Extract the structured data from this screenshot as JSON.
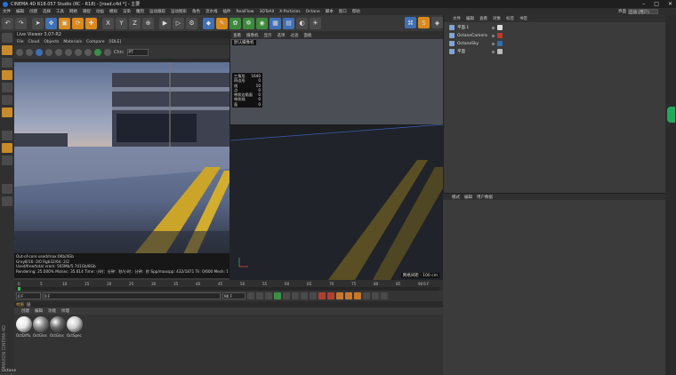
{
  "window": {
    "title": "CINEMA 4D R18.057 Studio (RC - R18) - [road.c4d *] - 主要"
  },
  "menu": {
    "items": [
      "文件",
      "编辑",
      "创建",
      "选择",
      "工具",
      "网格",
      "捕捉",
      "动画",
      "模拟",
      "渲染",
      "雕刻",
      "运动跟踪",
      "运动图形",
      "角色",
      "流水线",
      "插件",
      "RealFlow",
      "3DToAll",
      "X-Particles",
      "Octane",
      "脚本",
      "窗口",
      "帮助"
    ],
    "layout_label": "界面",
    "layout_value": "启动 (用户)"
  },
  "toolbar": {
    "icons": [
      "undo-icon",
      "redo-icon",
      "select-arrow-icon",
      "move-icon",
      "scale-icon",
      "rotate-icon",
      "plus-icon",
      "x-axis-icon",
      "y-axis-icon",
      "z-axis-icon",
      "coordinate-icon",
      "cube-icon",
      "pen-icon",
      "subdivide-icon",
      "array-icon",
      "deformer-icon",
      "floor-icon",
      "camera-icon",
      "light-icon"
    ],
    "x_label": "X",
    "y_label": "Y",
    "z_label": "Z"
  },
  "live_viewer": {
    "title": "Live Viewer 3.07-R2",
    "menu": [
      "File",
      "Cloud",
      "Objects",
      "Materials",
      "Compare",
      "[IDLE]"
    ],
    "channel_label": "Chn:",
    "channel_value": "PT",
    "info": [
      "Out-of-core used/max:0Kb/4Gb",
      "Grey8/16: 0/0      Rgb32/64: 2/2",
      "Used/free/total vram: 565Mb/5.741Gb/8Gb",
      "Rendering: 25.000%   Ms/sec: 35.614   Time: 小时：分钟：秒/小时：分钟：秒   Spp/maxspp: 432/1871   Tri: 0/600   Mesh: 1   Hai"
    ]
  },
  "viewport": {
    "menu": [
      "查看",
      "摄像机",
      "显示",
      "选项",
      "过滤",
      "面板"
    ],
    "label": "默认摄像机",
    "stats": [
      {
        "k": "三角形",
        "v": "1640"
      },
      {
        "k": "四边形",
        "v": "0"
      },
      {
        "k": "线",
        "v": "10"
      },
      {
        "k": "点",
        "v": "0"
      },
      {
        "k": "带状边角面",
        "v": "0"
      },
      {
        "k": "带状线",
        "v": "0"
      },
      {
        "k": "面",
        "v": "0"
      }
    ],
    "grid_label": "网格间距 : 100 cm"
  },
  "timeline": {
    "ticks": [
      "0",
      "5",
      "10",
      "15",
      "20",
      "25",
      "30",
      "35",
      "40",
      "45",
      "50",
      "55",
      "60",
      "65",
      "70",
      "75",
      "80",
      "85",
      "90"
    ],
    "current_frame": "0 F",
    "start_frame": "0 F",
    "end_frame": "90 F",
    "max_frame": "90 F",
    "end_label": "0 F"
  },
  "materials": {
    "tabs": [
      "材质",
      "层"
    ],
    "menu": [
      "创建",
      "编辑",
      "功能",
      "纹理"
    ],
    "items": [
      {
        "name": "OctDiffu",
        "color": "#e8e8e8"
      },
      {
        "name": "OctGlos",
        "color": "#8a8a8a"
      },
      {
        "name": "OctGlos",
        "color": "#6a6a6a"
      },
      {
        "name": "OctSpec",
        "color": "#cfcfcf"
      }
    ]
  },
  "objects": {
    "menu": [
      "文件",
      "编辑",
      "查看",
      "对象",
      "标签",
      "书签"
    ],
    "rows": [
      {
        "name": "平面.1",
        "color": "#a9c7e8"
      },
      {
        "name": "OctaneCamera",
        "color": "#a9c7e8"
      },
      {
        "name": "OctaneSky",
        "color": "#a9c7e8"
      },
      {
        "name": "平面",
        "color": "#a9c7e8"
      }
    ]
  },
  "attributes": {
    "menu": [
      "模式",
      "编辑",
      "用户数据"
    ]
  },
  "bottom_label": "Octane"
}
